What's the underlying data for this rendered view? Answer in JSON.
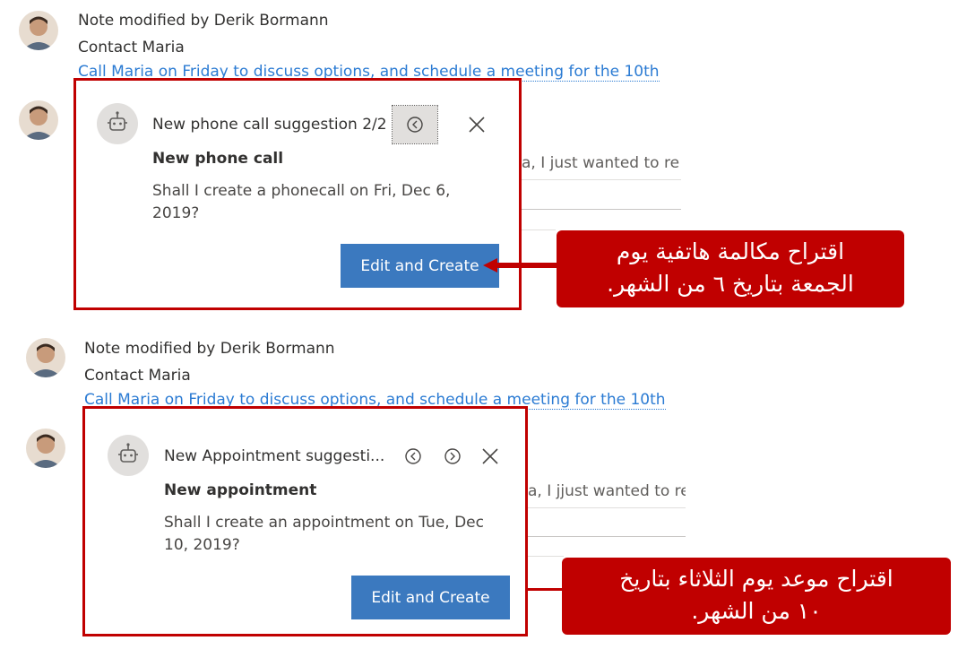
{
  "top": {
    "note": {
      "title": "Note modified by Derik Bormann",
      "subject": "Contact Maria",
      "link": "Call Maria on Friday to discuss options, and schedule a meeting for the 10th"
    },
    "behind_text": "a, I just wanted to re",
    "card": {
      "header": "New phone call suggestion 2/2",
      "title": "New phone call",
      "body": "Shall I create a phonecall on Fri, Dec 6, 2019?",
      "button": "Edit and Create",
      "icons": [
        "bot-icon",
        "chevron-left-icon",
        "close-icon"
      ]
    },
    "callout": {
      "line1": "اقتراح مكالمة هاتفية يوم",
      "line2": "الجمعة بتاريخ ٦ من الشهر."
    }
  },
  "bottom": {
    "note": {
      "title": "Note modified by Derik Bormann",
      "subject": "Contact Maria",
      "link": "Call Maria on Friday to discuss options, and schedule a meeting for the 10th"
    },
    "behind_text": "a, I jjust wanted to re",
    "card": {
      "header": "New Appointment suggesti...",
      "title": "New appointment",
      "body": "Shall I create an appointment on Tue, Dec 10, 2019?",
      "button": "Edit and Create",
      "icons": [
        "bot-icon",
        "chevron-left-icon",
        "chevron-right-icon",
        "close-icon"
      ]
    },
    "callout": {
      "line1": "اقتراح موعد يوم الثلاثاء بتاريخ",
      "line2": "١٠ من الشهر."
    }
  },
  "colors": {
    "highlight": "#c00000",
    "button": "#3b79bf",
    "link": "#2b7bd3"
  }
}
